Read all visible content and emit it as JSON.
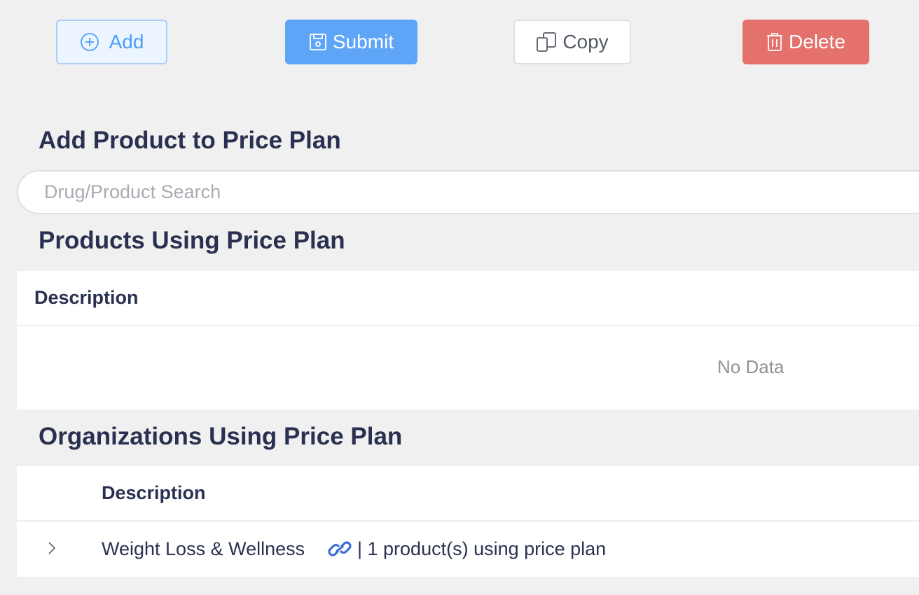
{
  "toolbar": {
    "add_label": "Add",
    "submit_label": "Submit",
    "copy_label": "Copy",
    "delete_label": "Delete"
  },
  "sections": {
    "add_product_title": "Add Product to Price Plan",
    "products_title": "Products Using Price Plan",
    "orgs_title": "Organizations Using Price Plan"
  },
  "search": {
    "placeholder": "Drug/Product Search",
    "value": ""
  },
  "products_table": {
    "columns": [
      "Description"
    ],
    "empty_text": "No Data",
    "rows": []
  },
  "orgs_table": {
    "columns": [
      "Description"
    ],
    "rows": [
      {
        "name": "Weight Loss & Wellness",
        "meta": "| 1 product(s) using price plan",
        "link_icon": "link-icon",
        "expand_icon": "chevron-right-icon"
      }
    ]
  },
  "colors": {
    "background": "#f0f0f0",
    "primary": "#5ea5f8",
    "primary_light": "#ecf5ff",
    "danger": "#e5716d",
    "heading": "#2a3150",
    "muted": "#909399"
  }
}
